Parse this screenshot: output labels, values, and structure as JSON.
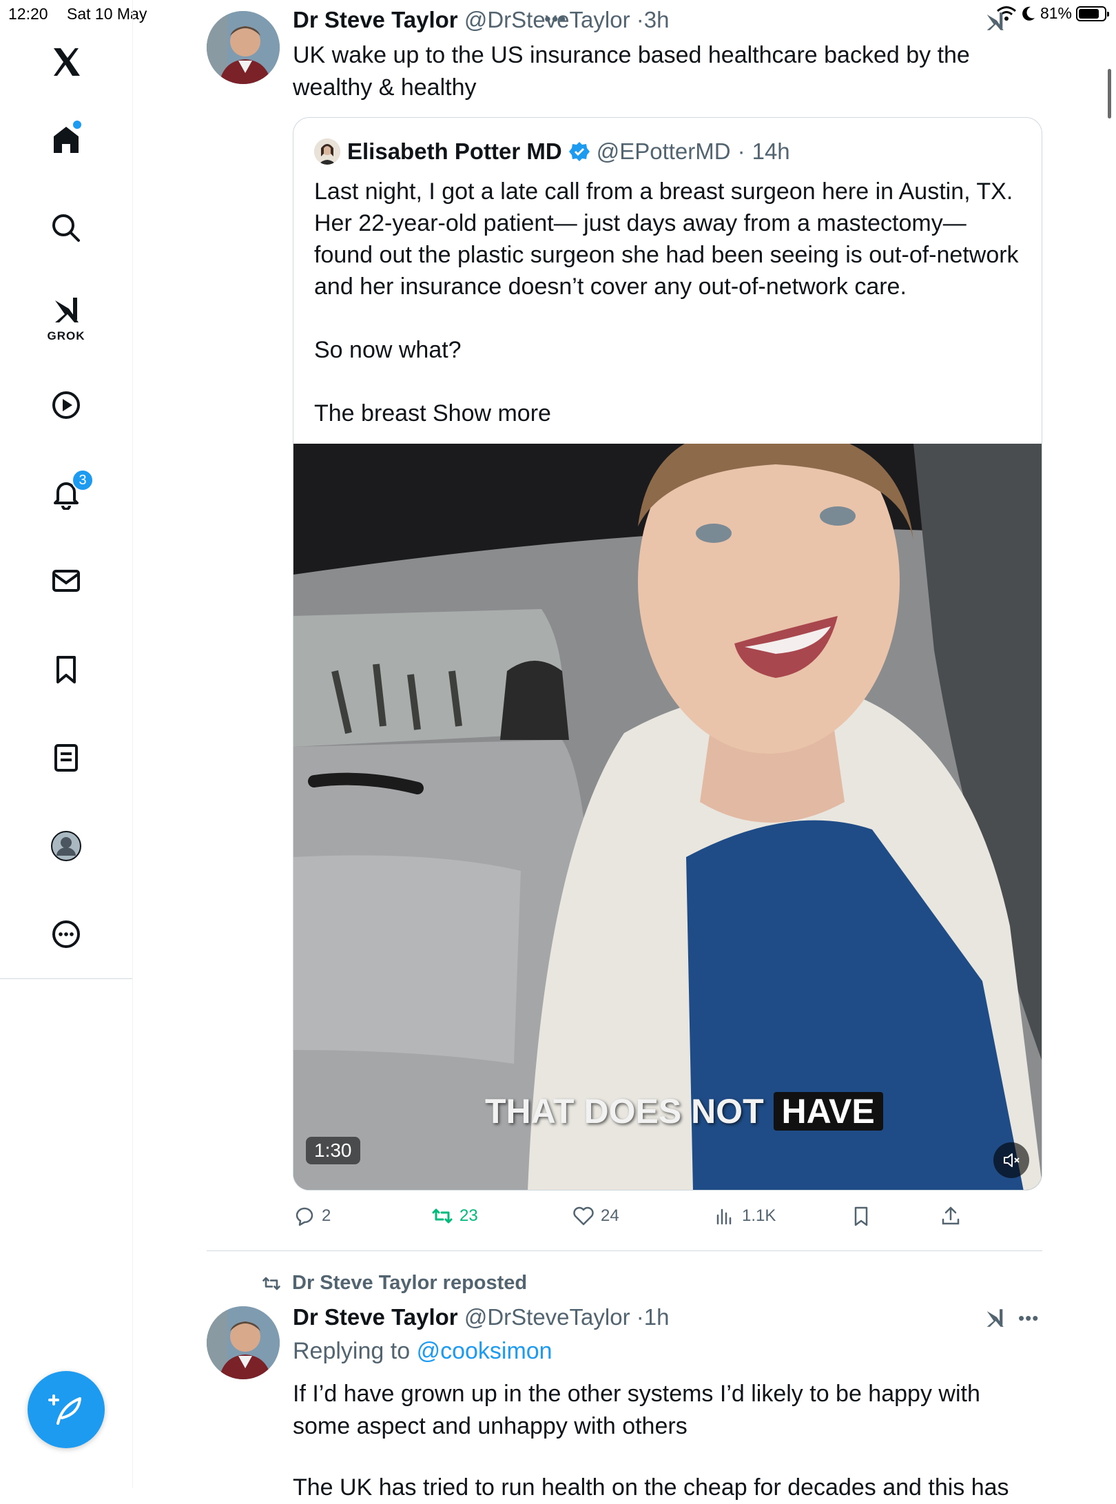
{
  "status_bar": {
    "time": "12:20",
    "date": "Sat 10 May",
    "battery": "81%",
    "battery_level": 0.81
  },
  "sidebar": {
    "grok_label": "GROK",
    "notifications_badge": "3",
    "items": [
      "x-logo-icon",
      "home-icon",
      "search-icon",
      "grok-icon",
      "video-icon",
      "notifications-icon",
      "messages-icon",
      "bookmarks-icon",
      "lists-icon",
      "profile-icon",
      "more-icon"
    ]
  },
  "tweet": {
    "author_name": "Dr Steve Taylor",
    "author_handle": "@DrSteveTaylor",
    "time": "3h",
    "text": "UK wake up to the US insurance based healthcare backed by the wealthy & healthy",
    "quote": {
      "author_name": "Elisabeth Potter MD",
      "author_handle": "@EPotterMD",
      "time": "14h",
      "text": "Last night, I got a late call from a breast surgeon here in Austin, TX. Her 22-year-old patient— just days away from a mastectomy— found out the plastic surgeon she had been seeing is out-of-network and her insurance doesn’t cover any out-of-network care.\n\nSo now what?\n\nThe breast",
      "show_more": "Show more",
      "video": {
        "caption_part1": "THAT DOES NOT",
        "caption_part2": "HAVE",
        "duration": "1:30"
      }
    },
    "actions": {
      "replies": "2",
      "reposts": "23",
      "likes": "24",
      "views": "1.1K"
    }
  },
  "second_tweet": {
    "repost_label": "Dr Steve Taylor reposted",
    "author_name": "Dr Steve Taylor",
    "author_handle": "@DrSteveTaylor",
    "time": "1h",
    "replying_prefix": "Replying to",
    "replying_handle": "@cooksimon",
    "text_line1": "If I’d have grown up in the other systems I’d likely to be happy with some aspect and unhappy with others",
    "text_line2": "The UK has tried to run health on the cheap for decades and this has"
  },
  "colors": {
    "accent": "#1d9bf0",
    "repost_active": "#00ba7c",
    "secondary_text": "#536471",
    "border": "#cfd9de"
  }
}
